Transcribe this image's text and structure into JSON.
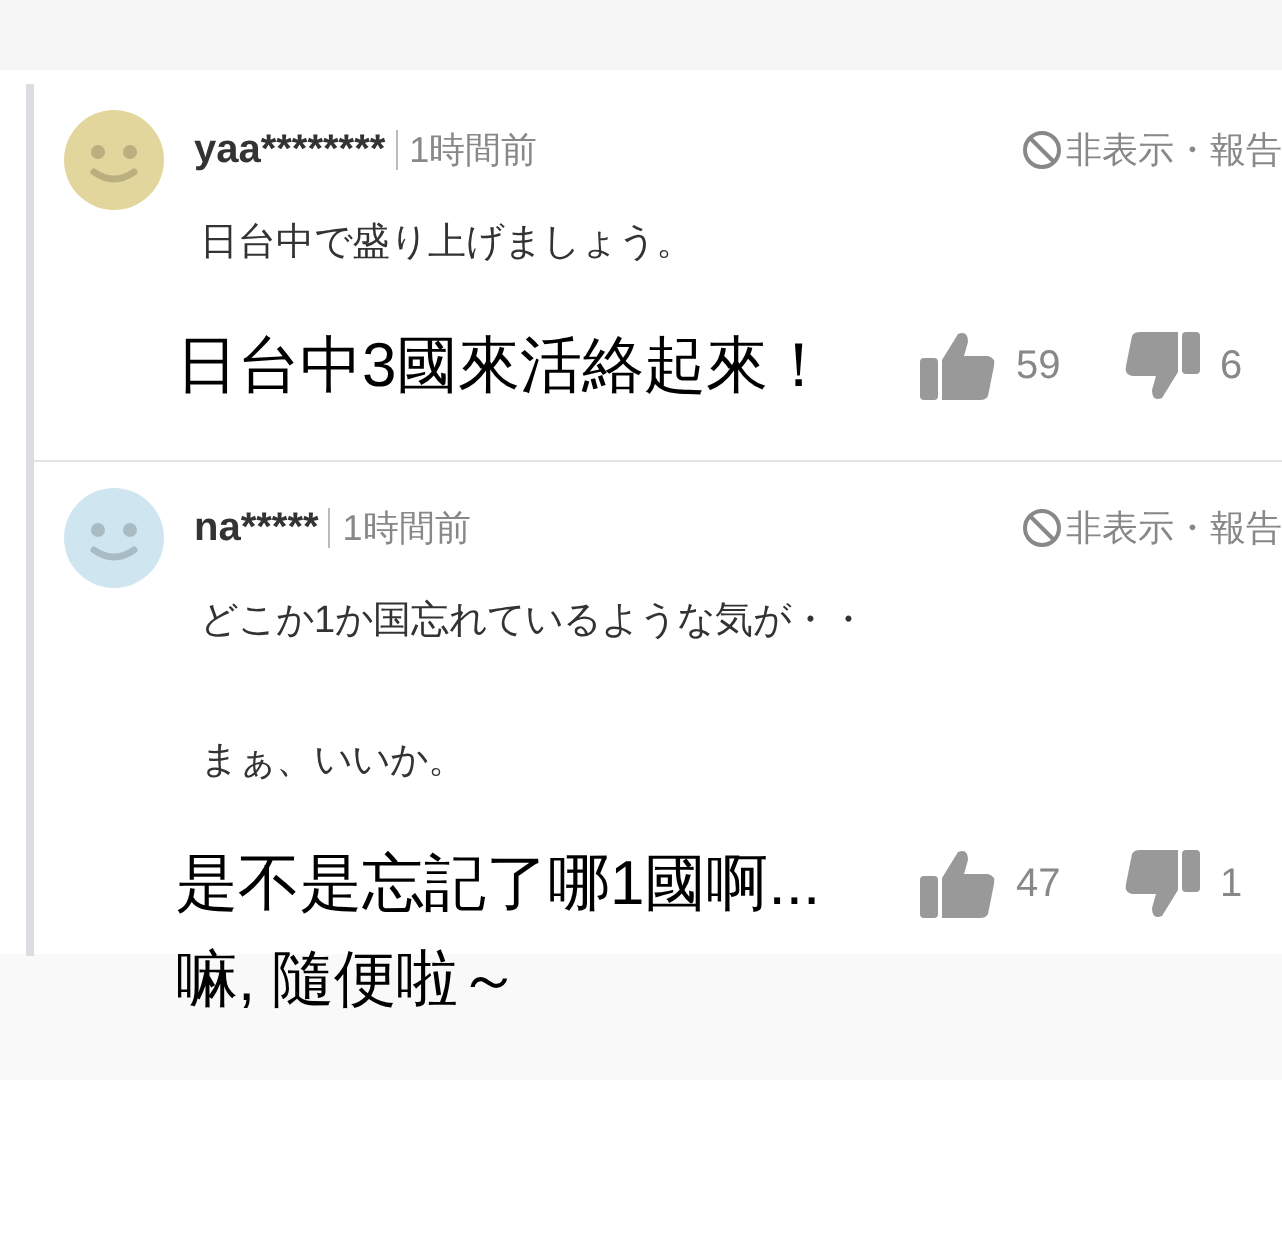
{
  "comments": [
    {
      "username": "yaa********",
      "time": "1時間前",
      "color": "#e3d69c",
      "hide_report": "非表示・報告",
      "body": [
        "日台中で盛り上げましょう。"
      ],
      "translation": [
        "日台中3國來活絡起來！"
      ],
      "likes": "59",
      "dislikes": "6"
    },
    {
      "username": "na*****",
      "time": "1時間前",
      "color": "#cfe6f0",
      "hide_report": "非表示・報告",
      "body": [
        "どこか1か国忘れているような気が・・",
        "まぁ、いいか。"
      ],
      "translation": [
        "是不是忘記了哪1國啊...",
        "嘛,  隨便啦～"
      ],
      "likes": "47",
      "dislikes": "1"
    }
  ]
}
